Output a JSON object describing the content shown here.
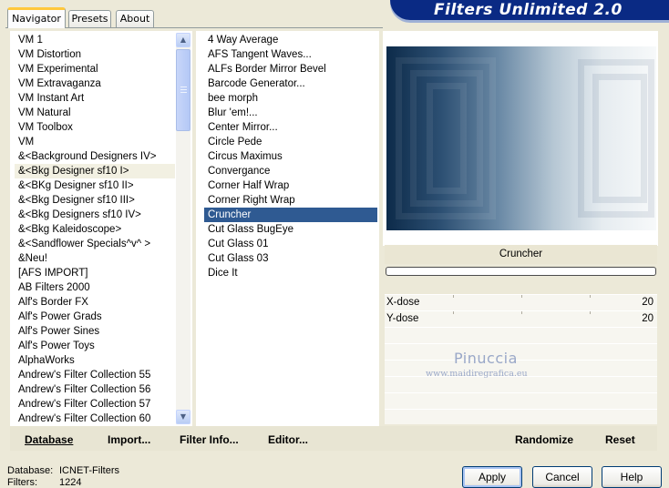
{
  "tabs": [
    {
      "label": "Navigator",
      "active": true
    },
    {
      "label": "Presets",
      "active": false
    },
    {
      "label": "About",
      "active": false
    }
  ],
  "app_title": "Filters Unlimited 2.0",
  "categories": {
    "items": [
      "VM 1",
      "VM Distortion",
      "VM Experimental",
      "VM Extravaganza",
      "VM Instant Art",
      "VM Natural",
      "VM Toolbox",
      "VM",
      "&<Background Designers IV>",
      "&<Bkg Designer sf10 I>",
      "&<BKg Designer sf10 II>",
      "&<Bkg Designer sf10 III>",
      "&<Bkg Designers sf10 IV>",
      "&<Bkg Kaleidoscope>",
      "&<Sandflower Specials^v^ >",
      "&Neu!",
      "[AFS IMPORT]",
      "AB Filters 2000",
      "Alf's Border FX",
      "Alf's Power Grads",
      "Alf's Power Sines",
      "Alf's Power Toys",
      "AlphaWorks",
      "Andrew's Filter Collection 55",
      "Andrew's Filter Collection 56",
      "Andrew's Filter Collection 57",
      "Andrew's Filter Collection 60"
    ],
    "highlighted_index": 9
  },
  "filters": {
    "items": [
      "4 Way Average",
      "AFS Tangent Waves...",
      "ALFs Border Mirror Bevel",
      "Barcode Generator...",
      "bee morph",
      "Blur 'em!...",
      "Center Mirror...",
      "Circle Pede",
      "Circus Maximus",
      "Convergance",
      "Corner Half Wrap",
      "Corner Right Wrap",
      "Cruncher",
      "Cut Glass  BugEye",
      "Cut Glass 01",
      "Cut Glass 03",
      "Dice It"
    ],
    "selected_index": 12
  },
  "selected_filter_name": "Cruncher",
  "params": [
    {
      "label": "X-dose",
      "value": "20"
    },
    {
      "label": "Y-dose",
      "value": "20"
    }
  ],
  "watermark": {
    "line1": "Pinuccia",
    "line2": "www.maidiregrafica.eu"
  },
  "links": {
    "database": "Database",
    "import": "Import...",
    "filter_info": "Filter Info...",
    "editor": "Editor...",
    "randomize": "Randomize",
    "reset": "Reset"
  },
  "status": {
    "database_label": "Database:",
    "database_value": "ICNET-Filters",
    "filters_label": "Filters:",
    "filters_value": "1224"
  },
  "buttons": {
    "apply": "Apply",
    "cancel": "Cancel",
    "help": "Help"
  },
  "colors": {
    "banner": "#0a2a84",
    "selection": "#2f5a92",
    "focus_tab": "#ffc83c"
  }
}
